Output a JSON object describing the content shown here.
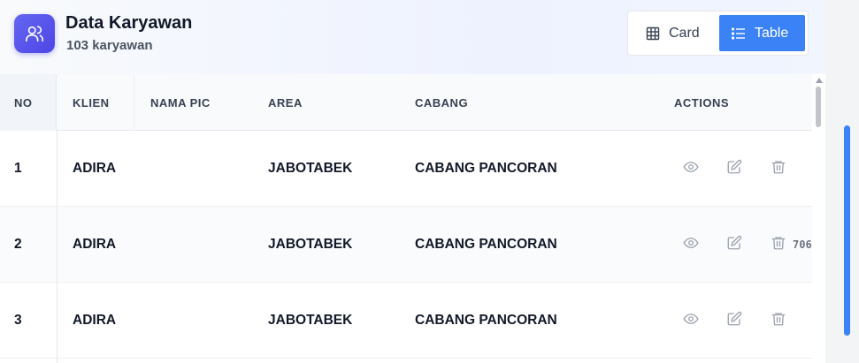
{
  "header": {
    "title": "Data Karyawan",
    "subtitle": "103 karyawan",
    "icon": "users-icon"
  },
  "view_toggle": {
    "card_label": "Card",
    "table_label": "Table",
    "active": "Table"
  },
  "table": {
    "columns": [
      "NO",
      "KLIEN",
      "NAMA PIC",
      "AREA",
      "CABANG",
      "ACTIONS"
    ],
    "rows": [
      {
        "no": "1",
        "klien": "ADIRA",
        "nama_pic": "",
        "area": "JABOTABEK",
        "cabang": "CABANG PANCORAN",
        "extra": ""
      },
      {
        "no": "2",
        "klien": "ADIRA",
        "nama_pic": "",
        "area": "JABOTABEK",
        "cabang": "CABANG PANCORAN",
        "extra": "706"
      },
      {
        "no": "3",
        "klien": "ADIRA",
        "nama_pic": "",
        "area": "JABOTABEK",
        "cabang": "CABANG PANCORAN",
        "extra": ""
      }
    ],
    "row_actions": [
      "eye-icon",
      "edit-icon",
      "trash-icon"
    ]
  },
  "colors": {
    "accent": "#3b82f6",
    "header_icon": "#4f46e5"
  }
}
